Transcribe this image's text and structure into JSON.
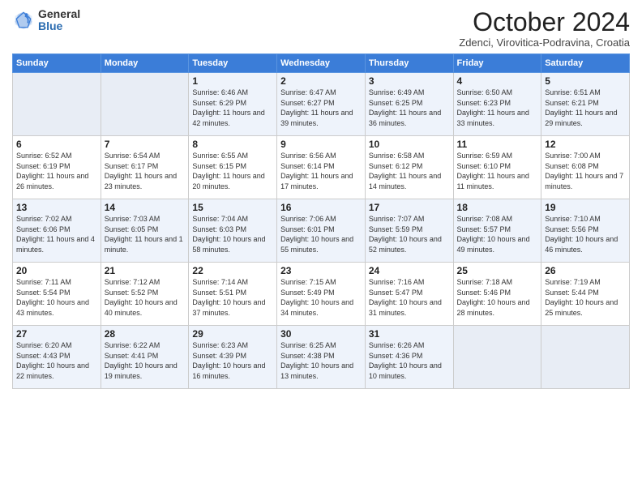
{
  "header": {
    "logo_general": "General",
    "logo_blue": "Blue",
    "month_title": "October 2024",
    "subtitle": "Zdenci, Virovitica-Podravina, Croatia"
  },
  "days_of_week": [
    "Sunday",
    "Monday",
    "Tuesday",
    "Wednesday",
    "Thursday",
    "Friday",
    "Saturday"
  ],
  "weeks": [
    [
      {
        "day": "",
        "info": ""
      },
      {
        "day": "",
        "info": ""
      },
      {
        "day": "1",
        "info": "Sunrise: 6:46 AM\nSunset: 6:29 PM\nDaylight: 11 hours and 42 minutes."
      },
      {
        "day": "2",
        "info": "Sunrise: 6:47 AM\nSunset: 6:27 PM\nDaylight: 11 hours and 39 minutes."
      },
      {
        "day": "3",
        "info": "Sunrise: 6:49 AM\nSunset: 6:25 PM\nDaylight: 11 hours and 36 minutes."
      },
      {
        "day": "4",
        "info": "Sunrise: 6:50 AM\nSunset: 6:23 PM\nDaylight: 11 hours and 33 minutes."
      },
      {
        "day": "5",
        "info": "Sunrise: 6:51 AM\nSunset: 6:21 PM\nDaylight: 11 hours and 29 minutes."
      }
    ],
    [
      {
        "day": "6",
        "info": "Sunrise: 6:52 AM\nSunset: 6:19 PM\nDaylight: 11 hours and 26 minutes."
      },
      {
        "day": "7",
        "info": "Sunrise: 6:54 AM\nSunset: 6:17 PM\nDaylight: 11 hours and 23 minutes."
      },
      {
        "day": "8",
        "info": "Sunrise: 6:55 AM\nSunset: 6:15 PM\nDaylight: 11 hours and 20 minutes."
      },
      {
        "day": "9",
        "info": "Sunrise: 6:56 AM\nSunset: 6:14 PM\nDaylight: 11 hours and 17 minutes."
      },
      {
        "day": "10",
        "info": "Sunrise: 6:58 AM\nSunset: 6:12 PM\nDaylight: 11 hours and 14 minutes."
      },
      {
        "day": "11",
        "info": "Sunrise: 6:59 AM\nSunset: 6:10 PM\nDaylight: 11 hours and 11 minutes."
      },
      {
        "day": "12",
        "info": "Sunrise: 7:00 AM\nSunset: 6:08 PM\nDaylight: 11 hours and 7 minutes."
      }
    ],
    [
      {
        "day": "13",
        "info": "Sunrise: 7:02 AM\nSunset: 6:06 PM\nDaylight: 11 hours and 4 minutes."
      },
      {
        "day": "14",
        "info": "Sunrise: 7:03 AM\nSunset: 6:05 PM\nDaylight: 11 hours and 1 minute."
      },
      {
        "day": "15",
        "info": "Sunrise: 7:04 AM\nSunset: 6:03 PM\nDaylight: 10 hours and 58 minutes."
      },
      {
        "day": "16",
        "info": "Sunrise: 7:06 AM\nSunset: 6:01 PM\nDaylight: 10 hours and 55 minutes."
      },
      {
        "day": "17",
        "info": "Sunrise: 7:07 AM\nSunset: 5:59 PM\nDaylight: 10 hours and 52 minutes."
      },
      {
        "day": "18",
        "info": "Sunrise: 7:08 AM\nSunset: 5:57 PM\nDaylight: 10 hours and 49 minutes."
      },
      {
        "day": "19",
        "info": "Sunrise: 7:10 AM\nSunset: 5:56 PM\nDaylight: 10 hours and 46 minutes."
      }
    ],
    [
      {
        "day": "20",
        "info": "Sunrise: 7:11 AM\nSunset: 5:54 PM\nDaylight: 10 hours and 43 minutes."
      },
      {
        "day": "21",
        "info": "Sunrise: 7:12 AM\nSunset: 5:52 PM\nDaylight: 10 hours and 40 minutes."
      },
      {
        "day": "22",
        "info": "Sunrise: 7:14 AM\nSunset: 5:51 PM\nDaylight: 10 hours and 37 minutes."
      },
      {
        "day": "23",
        "info": "Sunrise: 7:15 AM\nSunset: 5:49 PM\nDaylight: 10 hours and 34 minutes."
      },
      {
        "day": "24",
        "info": "Sunrise: 7:16 AM\nSunset: 5:47 PM\nDaylight: 10 hours and 31 minutes."
      },
      {
        "day": "25",
        "info": "Sunrise: 7:18 AM\nSunset: 5:46 PM\nDaylight: 10 hours and 28 minutes."
      },
      {
        "day": "26",
        "info": "Sunrise: 7:19 AM\nSunset: 5:44 PM\nDaylight: 10 hours and 25 minutes."
      }
    ],
    [
      {
        "day": "27",
        "info": "Sunrise: 6:20 AM\nSunset: 4:43 PM\nDaylight: 10 hours and 22 minutes."
      },
      {
        "day": "28",
        "info": "Sunrise: 6:22 AM\nSunset: 4:41 PM\nDaylight: 10 hours and 19 minutes."
      },
      {
        "day": "29",
        "info": "Sunrise: 6:23 AM\nSunset: 4:39 PM\nDaylight: 10 hours and 16 minutes."
      },
      {
        "day": "30",
        "info": "Sunrise: 6:25 AM\nSunset: 4:38 PM\nDaylight: 10 hours and 13 minutes."
      },
      {
        "day": "31",
        "info": "Sunrise: 6:26 AM\nSunset: 4:36 PM\nDaylight: 10 hours and 10 minutes."
      },
      {
        "day": "",
        "info": ""
      },
      {
        "day": "",
        "info": ""
      }
    ]
  ]
}
